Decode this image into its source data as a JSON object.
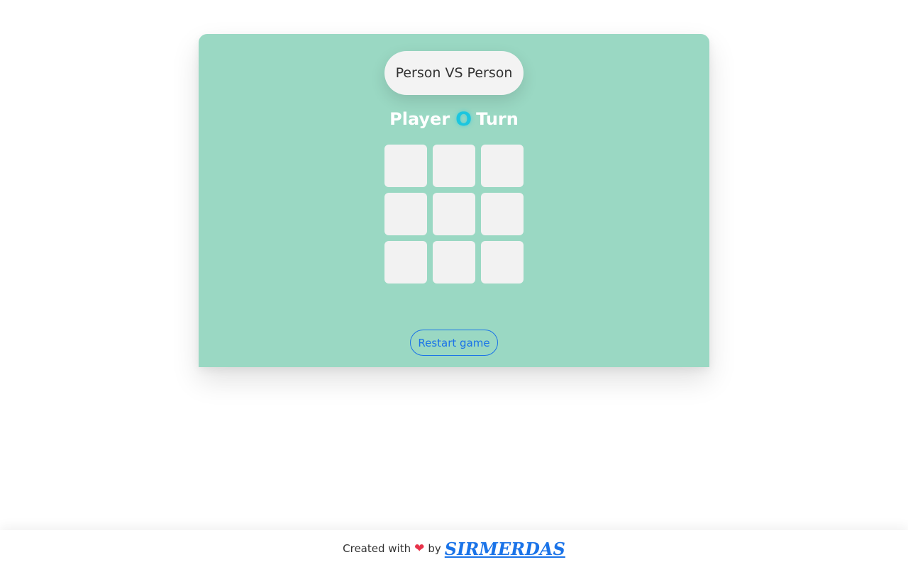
{
  "game": {
    "mode_label": "Person VS Person",
    "turn": {
      "prefix": "Player",
      "player": "O",
      "suffix": "Turn"
    },
    "board": {
      "cells": [
        "",
        "",
        "",
        "",
        "",
        "",
        "",
        "",
        ""
      ]
    },
    "restart_label": "Restart game"
  },
  "footer": {
    "created_with": "Created with",
    "heart_icon": "heart-icon",
    "by": "by",
    "author": "SIRMERDAS"
  },
  "colors": {
    "card_background": "#9ad8c3",
    "cell_background": "#f2f2f2",
    "player_accent": "#1cc6df",
    "link_blue": "#1a73e8",
    "heart_red": "#e8334a"
  }
}
